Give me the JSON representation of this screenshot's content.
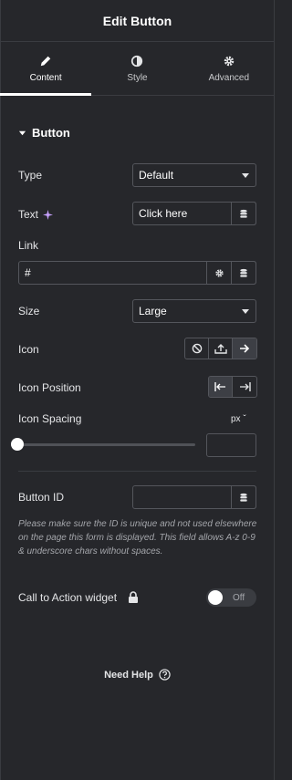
{
  "header": {
    "title": "Edit Button"
  },
  "tabs": [
    {
      "label": "Content",
      "icon": "pencil-icon",
      "active": true
    },
    {
      "label": "Style",
      "icon": "half-circle-icon",
      "active": false
    },
    {
      "label": "Advanced",
      "icon": "gear-icon",
      "active": false
    }
  ],
  "section": {
    "title": "Button"
  },
  "fields": {
    "type": {
      "label": "Type",
      "value": "Default"
    },
    "text": {
      "label": "Text",
      "value": "Click here"
    },
    "link": {
      "label": "Link",
      "value": "#"
    },
    "size": {
      "label": "Size",
      "value": "Large"
    },
    "icon": {
      "label": "Icon"
    },
    "icon_position": {
      "label": "Icon Position"
    },
    "icon_spacing": {
      "label": "Icon Spacing",
      "unit": "px ˇ",
      "value": ""
    },
    "button_id": {
      "label": "Button ID",
      "value": "",
      "hint": "Please make sure the ID is unique and not used elsewhere on the page this form is displayed. This field allows A-z  0-9 & underscore chars without spaces."
    },
    "cta": {
      "label": "Call to Action widget",
      "toggle": "Off"
    }
  },
  "help": {
    "label": "Need Help"
  },
  "colors": {
    "background": "#26272b",
    "border": "#54565c",
    "accent": "#ffffff"
  }
}
